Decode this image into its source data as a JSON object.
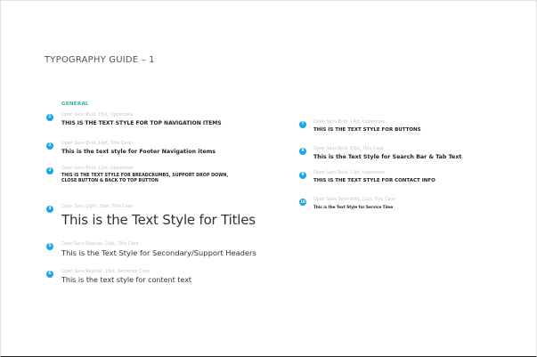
{
  "page": {
    "title": "TYPOGRAPHY GUIDE – 1",
    "section": "GENERAL"
  },
  "left": [
    {
      "num": "1",
      "meta": "Open Sans Bold, 15pt, Uppercase",
      "sample": "THIS IS THE TEXT STYLE FOR TOP NAVIGATION ITEMS"
    },
    {
      "num": "2",
      "meta": "Open Sans Bold, 14pt, Title Case",
      "sample": "This is the text style for Footer Navigation items"
    },
    {
      "num": "3",
      "meta": "Open Sans Bold, 12pt, Uppercase",
      "sample": "THIS IS THE TEXT STYLE FOR BREADCRUMBS, SUPPORT DROP DOWN,",
      "sample2": "CLOSE BUTTON & BACK TO TOP BUTTON"
    },
    {
      "num": "4",
      "meta": "Open Sans Light, 36pt, Title Case",
      "sample": "This is the Text Style for Titles"
    },
    {
      "num": "5",
      "meta": "Open Sans Regular, 20pt, Title Case",
      "sample": "This is the Text Style for Secondary/Support Headers"
    },
    {
      "num": "6",
      "meta": "Open Sans Regular, 18pt, Sentence Case",
      "sample": "This is the text style for content text"
    }
  ],
  "right": [
    {
      "num": "7",
      "meta": "Open Sans Bold, 14pt, Uppercase",
      "sample": "THIS IS THE TEXT STYLE FOR BUTTONS"
    },
    {
      "num": "8",
      "meta": "Open Sans Bold, 15pt, Title Case",
      "sample": "This is the Text Style for Search Bar & Tab Text"
    },
    {
      "num": "9",
      "meta": "Open Sans Bold, 13pt, Uppercase",
      "sample": "THIS IS THE TEXT STYLE FOR CONTACT INFO"
    },
    {
      "num": "10",
      "meta": "Open Sans Semi bold, 11pt, Title Case",
      "sample": "This is the Text Style for Service Time"
    }
  ],
  "colors": {
    "accent": "#1aa7e3",
    "section_label": "#2bb39a"
  }
}
